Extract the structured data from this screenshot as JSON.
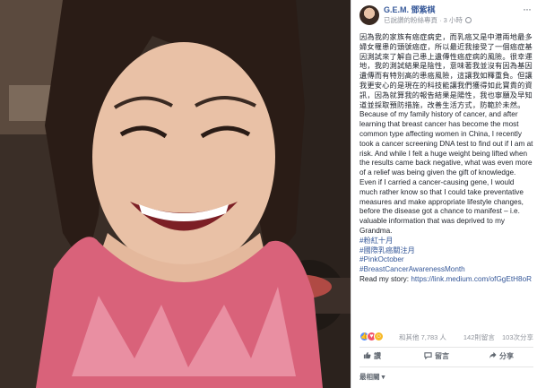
{
  "post": {
    "author": "G.E.M. 鄧紫棋",
    "subline": "已說讚的粉絲專頁 · 3 小時",
    "more_icon": "more-dots-icon",
    "paragraph_zh": "因為我的家族有癌症病史，而乳癌又是中港兩地最多婦女罹患的頭號癌症，所以最近我接受了一個癌症基因測試來了解自己患上遺傳性癌症病的風險。很幸運地，我的測試結果是陰性，意味著我並沒有因為基因遺傳而有特別高的患癌風險，這讓我如釋重負。但讓我更安心的是現在的科技能讓我們獲得如此寶貴的資訊，因為就算我的報告結果是陽性，我也寧願及早知道並採取預防措施，改善生活方式，防範於未然。",
    "paragraph_en": "Because of my family history of cancer, and after learning that breast cancer has become the most common type affecting women in China, I recently took a cancer screening DNA test to find out if I am at risk. And while I felt a huge weight being lifted when the results came back negative, what was even more of a relief was being given the gift of knowledge. Even if I carried a cancer-causing gene, I would much rather know so that I could take preventative measures and make appropriate lifestyle changes, before the disease got a chance to manifest – i.e. valuable information that was deprived to my Grandma.",
    "hashtags": [
      "#粉紅十月",
      "#國際乳癌關注月",
      "#PinkOctober",
      "#BreastCancerAwarenessMonth"
    ],
    "story_label": "Read my story: ",
    "story_link": "https://link.medium.com/ofGgEtH8oR"
  },
  "reactions": {
    "icons": [
      "like-reaction-icon",
      "love-reaction-icon",
      "haha-reaction-icon"
    ],
    "summary": "和其他 7,783 人",
    "comments": "142則留言",
    "shares": "103次分享"
  },
  "actions": {
    "like": "讚",
    "comment": "留言",
    "share": "分享"
  },
  "comments_filter": "最相關 ▾",
  "colors": {
    "link": "#365899",
    "text": "#1d2129",
    "meta": "#90949c"
  }
}
